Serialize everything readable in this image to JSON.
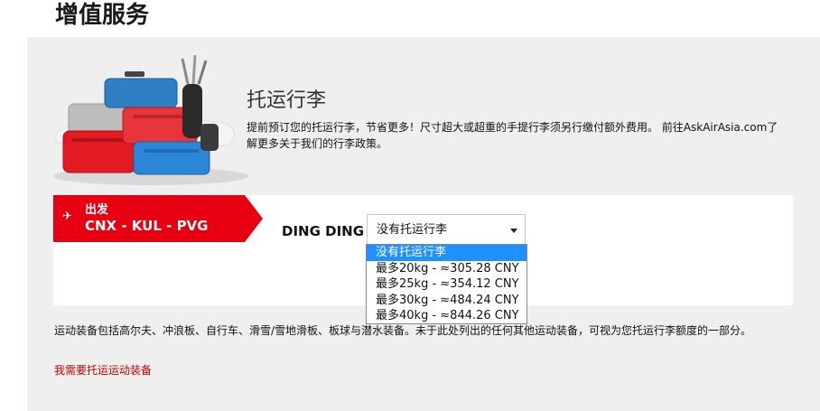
{
  "page": {
    "title": "增值服务"
  },
  "baggage": {
    "title": "托运行李",
    "description": "提前预订您的托运行李，节省更多！尺寸超大或超重的手提行李须另行缴付额外费用。 前往AskAirAsia.com了解更多关于我们的行李政策。"
  },
  "flight": {
    "plane_icon": "plane-icon",
    "departure_label": "出发",
    "route": "CNX - KUL - PVG",
    "passenger": "DING DING",
    "selected_value": "没有托运行李",
    "options": [
      "没有托运行李",
      "最多20kg - ≈305.28 CNY",
      "最多25kg - ≈354.12 CNY",
      "最多30kg - ≈484.24 CNY",
      "最多40kg - ≈844.26 CNY"
    ]
  },
  "sports": {
    "note": "运动装备包括高尔夫、冲浪板、自行车、滑雪/雪地滑板、板球与潜水装备。未于此处列出的任何其他运动装备，可视为您托运行李额度的一部分。",
    "link": "我需要托运运动装备"
  },
  "colors": {
    "brand_red": "#e60012",
    "highlight": "#1e90ff",
    "link_red": "#c00000"
  }
}
